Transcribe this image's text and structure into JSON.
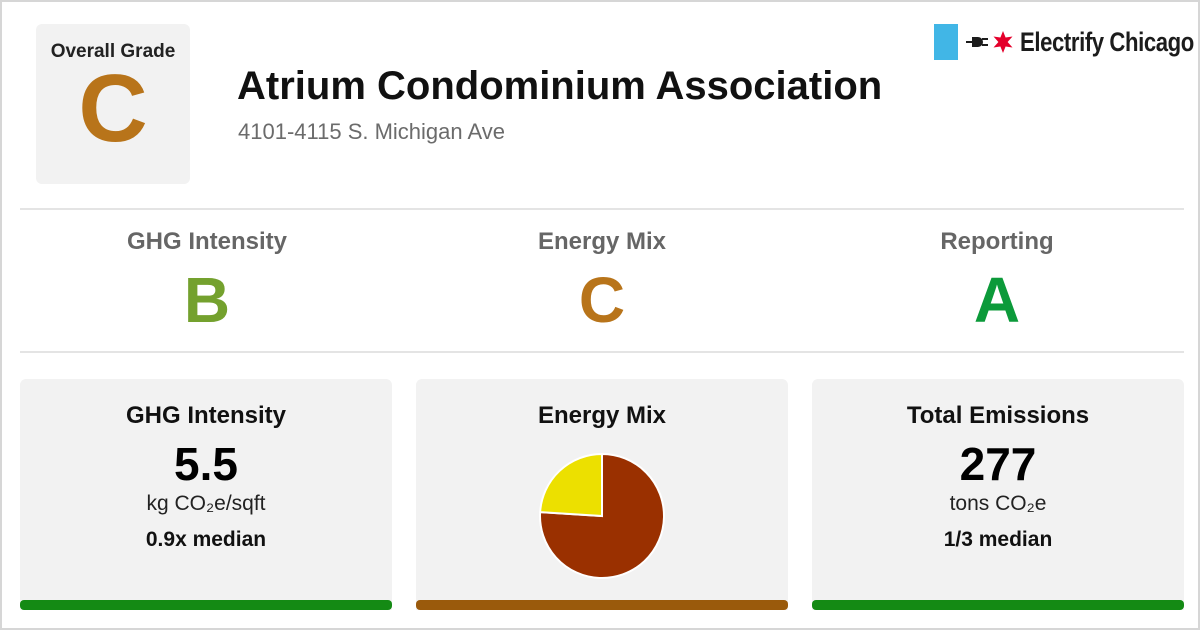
{
  "colors": {
    "grade_A": "#0c9a3a",
    "grade_B": "#74a12e",
    "grade_C": "#b8741a",
    "bar_good": "#148a14",
    "bar_mid": "#9a5a0c",
    "pie_main": "#9a3000",
    "pie_minor": "#ece000"
  },
  "header": {
    "overall_label": "Overall Grade",
    "overall_grade": "C",
    "title": "Atrium Condominium Association",
    "address": "4101-4115 S. Michigan Ave"
  },
  "brand": {
    "name": "Electrify Chicago",
    "icons": [
      "chicago-flag-stripe-icon",
      "plug-icon",
      "red-star-icon"
    ]
  },
  "subgrades": [
    {
      "label": "GHG Intensity",
      "grade": "B"
    },
    {
      "label": "Energy Mix",
      "grade": "C"
    },
    {
      "label": "Reporting",
      "grade": "A"
    }
  ],
  "metrics": {
    "ghg": {
      "title": "GHG Intensity",
      "value": "5.5",
      "unit": "kg CO₂e/sqft",
      "compare": "0.9x median"
    },
    "energy_mix": {
      "title": "Energy Mix",
      "pie": [
        {
          "share": 0.76
        },
        {
          "share": 0.24
        }
      ]
    },
    "emissions": {
      "title": "Total Emissions",
      "value": "277",
      "unit": "tons CO₂e",
      "compare": "1/3 median"
    }
  }
}
